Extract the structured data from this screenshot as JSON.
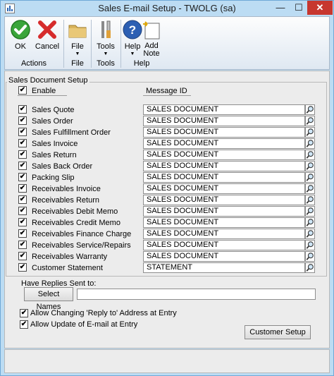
{
  "window": {
    "title": "Sales E-mail Setup  -  TWOLG (sa)",
    "minimize": "—",
    "maximize": "☐",
    "close": "✕"
  },
  "toolbar": {
    "ok": "OK",
    "cancel": "Cancel",
    "file": "File",
    "tools": "Tools",
    "help": "Help",
    "add_note": "Add Note",
    "dropdown_arrow": "▼",
    "groups": {
      "actions": "Actions",
      "file": "File",
      "tools": "Tools",
      "help": "Help"
    }
  },
  "setup": {
    "group_title": "Sales Document Setup",
    "enable_label": "Enable",
    "enable_checked": true,
    "message_id_header": "Message ID",
    "rows": [
      {
        "label": "Sales Quote",
        "checked": true,
        "value": "SALES DOCUMENT"
      },
      {
        "label": "Sales Order",
        "checked": true,
        "value": "SALES DOCUMENT"
      },
      {
        "label": "Sales Fulfillment Order",
        "checked": true,
        "value": "SALES DOCUMENT"
      },
      {
        "label": "Sales Invoice",
        "checked": true,
        "value": "SALES DOCUMENT"
      },
      {
        "label": "Sales Return",
        "checked": true,
        "value": "SALES DOCUMENT"
      },
      {
        "label": "Sales Back Order",
        "checked": true,
        "value": "SALES DOCUMENT"
      },
      {
        "label": "Packing Slip",
        "checked": true,
        "value": "SALES DOCUMENT"
      },
      {
        "label": "Receivables Invoice",
        "checked": true,
        "value": "SALES DOCUMENT"
      },
      {
        "label": "Receivables Return",
        "checked": true,
        "value": "SALES DOCUMENT"
      },
      {
        "label": "Receivables Debit Memo",
        "checked": true,
        "value": "SALES DOCUMENT"
      },
      {
        "label": "Receivables Credit Memo",
        "checked": true,
        "value": "SALES DOCUMENT"
      },
      {
        "label": "Receivables Finance Charge",
        "checked": true,
        "value": "SALES DOCUMENT"
      },
      {
        "label": "Receivables Service/Repairs",
        "checked": true,
        "value": "SALES DOCUMENT"
      },
      {
        "label": "Receivables Warranty",
        "checked": true,
        "value": "SALES DOCUMENT"
      },
      {
        "label": "Customer Statement",
        "checked": true,
        "value": "STATEMENT"
      }
    ]
  },
  "replies": {
    "label": "Have Replies Sent to:",
    "select_button": "Select Names",
    "value": ""
  },
  "options": {
    "allow_reply_to": "Allow Changing 'Reply to' Address at Entry",
    "allow_reply_to_checked": true,
    "allow_email_update": "Allow Update of E-mail at Entry",
    "allow_email_update_checked": true
  },
  "customer_setup_button": "Customer Setup"
}
